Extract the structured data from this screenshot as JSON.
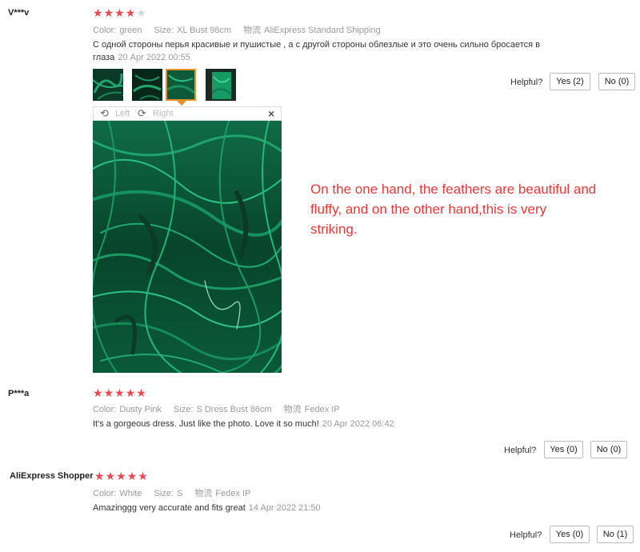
{
  "colors": {
    "star": "#e8474f",
    "accent": "#e7902a",
    "overlay_text": "#e23a3a"
  },
  "helpful_label": "Helpful?",
  "reviews": [
    {
      "name": "V***v",
      "stars": 4,
      "attributes": [
        {
          "key": "Color:",
          "value": "green"
        },
        {
          "key": "Size:",
          "value": "XL Bust 98cm"
        },
        {
          "key": "物流",
          "value": "AliExpress Standard Shipping"
        }
      ],
      "text_line1": "С одной стороны перья красивые и пушистые , а с другой стороны облезлые и это очень сильно бросается в",
      "text_line2": "глаза",
      "date": "20 Apr 2022 00:55",
      "yes_label": "Yes (2)",
      "no_label": "No (0)",
      "thumbnails": [
        "photo-1",
        "photo-2",
        "photo-3",
        "photo-4"
      ],
      "selected_thumbnail": 3,
      "viewer": {
        "rotate_left": "Left",
        "rotate_right": "Right",
        "close": "×"
      }
    },
    {
      "name": "P***a",
      "stars": 5,
      "attributes": [
        {
          "key": "Color:",
          "value": "Dusty Pink"
        },
        {
          "key": "Size:",
          "value": "S Dress Bust 86cm"
        },
        {
          "key": "物流",
          "value": "Fedex IP"
        }
      ],
      "text": "It's a gorgeous dress. Just like the photo. Love it so much!",
      "date": "20 Apr 2022 06:42",
      "yes_label": "Yes (0)",
      "no_label": "No (0)"
    },
    {
      "name": "AliExpress Shopper",
      "stars": 5,
      "attributes": [
        {
          "key": "Color:",
          "value": "White"
        },
        {
          "key": "Size:",
          "value": "S"
        },
        {
          "key": "物流",
          "value": "Fedex IP"
        }
      ],
      "text": "Amazinggg very accurate and fits great",
      "date": "14 Apr 2022 21:50",
      "yes_label": "Yes (0)",
      "no_label": "No (1)"
    }
  ],
  "translation_note": {
    "line1": "On the one hand, the feathers are beautiful and",
    "line2": "fluffy, and on the other hand,this is very",
    "line3": "striking."
  }
}
